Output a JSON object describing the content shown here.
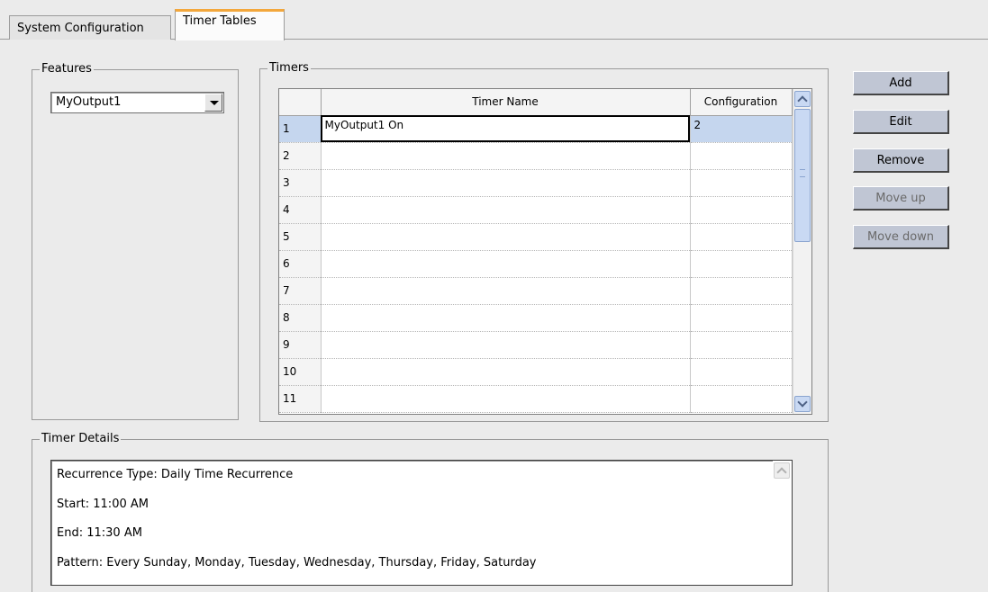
{
  "tabs": [
    {
      "label": "System Configuration",
      "active": false
    },
    {
      "label": "Timer Tables",
      "active": true
    }
  ],
  "features": {
    "title": "Features",
    "selected": "MyOutput1"
  },
  "timers": {
    "title": "Timers",
    "columns": [
      "Timer Name",
      "Configuration"
    ],
    "rows": [
      {
        "num": "1",
        "name": "MyOutput1 On",
        "config": "2"
      },
      {
        "num": "2",
        "name": "",
        "config": ""
      },
      {
        "num": "3",
        "name": "",
        "config": ""
      },
      {
        "num": "4",
        "name": "",
        "config": ""
      },
      {
        "num": "5",
        "name": "",
        "config": ""
      },
      {
        "num": "6",
        "name": "",
        "config": ""
      },
      {
        "num": "7",
        "name": "",
        "config": ""
      },
      {
        "num": "8",
        "name": "",
        "config": ""
      },
      {
        "num": "9",
        "name": "",
        "config": ""
      },
      {
        "num": "10",
        "name": "",
        "config": ""
      },
      {
        "num": "11",
        "name": "",
        "config": ""
      }
    ]
  },
  "buttons": {
    "add": "Add",
    "edit": "Edit",
    "remove": "Remove",
    "move_up": "Move up",
    "move_down": "Move down"
  },
  "details": {
    "title": "Timer Details",
    "lines": [
      "Recurrence Type: Daily Time Recurrence",
      "Start: 11:00 AM",
      "End: 11:30 AM",
      "Pattern: Every Sunday, Monday, Tuesday, Wednesday, Thursday, Friday, Saturday"
    ]
  },
  "colors": {
    "active_tab_accent": "#f3a73c",
    "selected_row": "#c5d6ee",
    "button_face": "#c0c6d4"
  }
}
